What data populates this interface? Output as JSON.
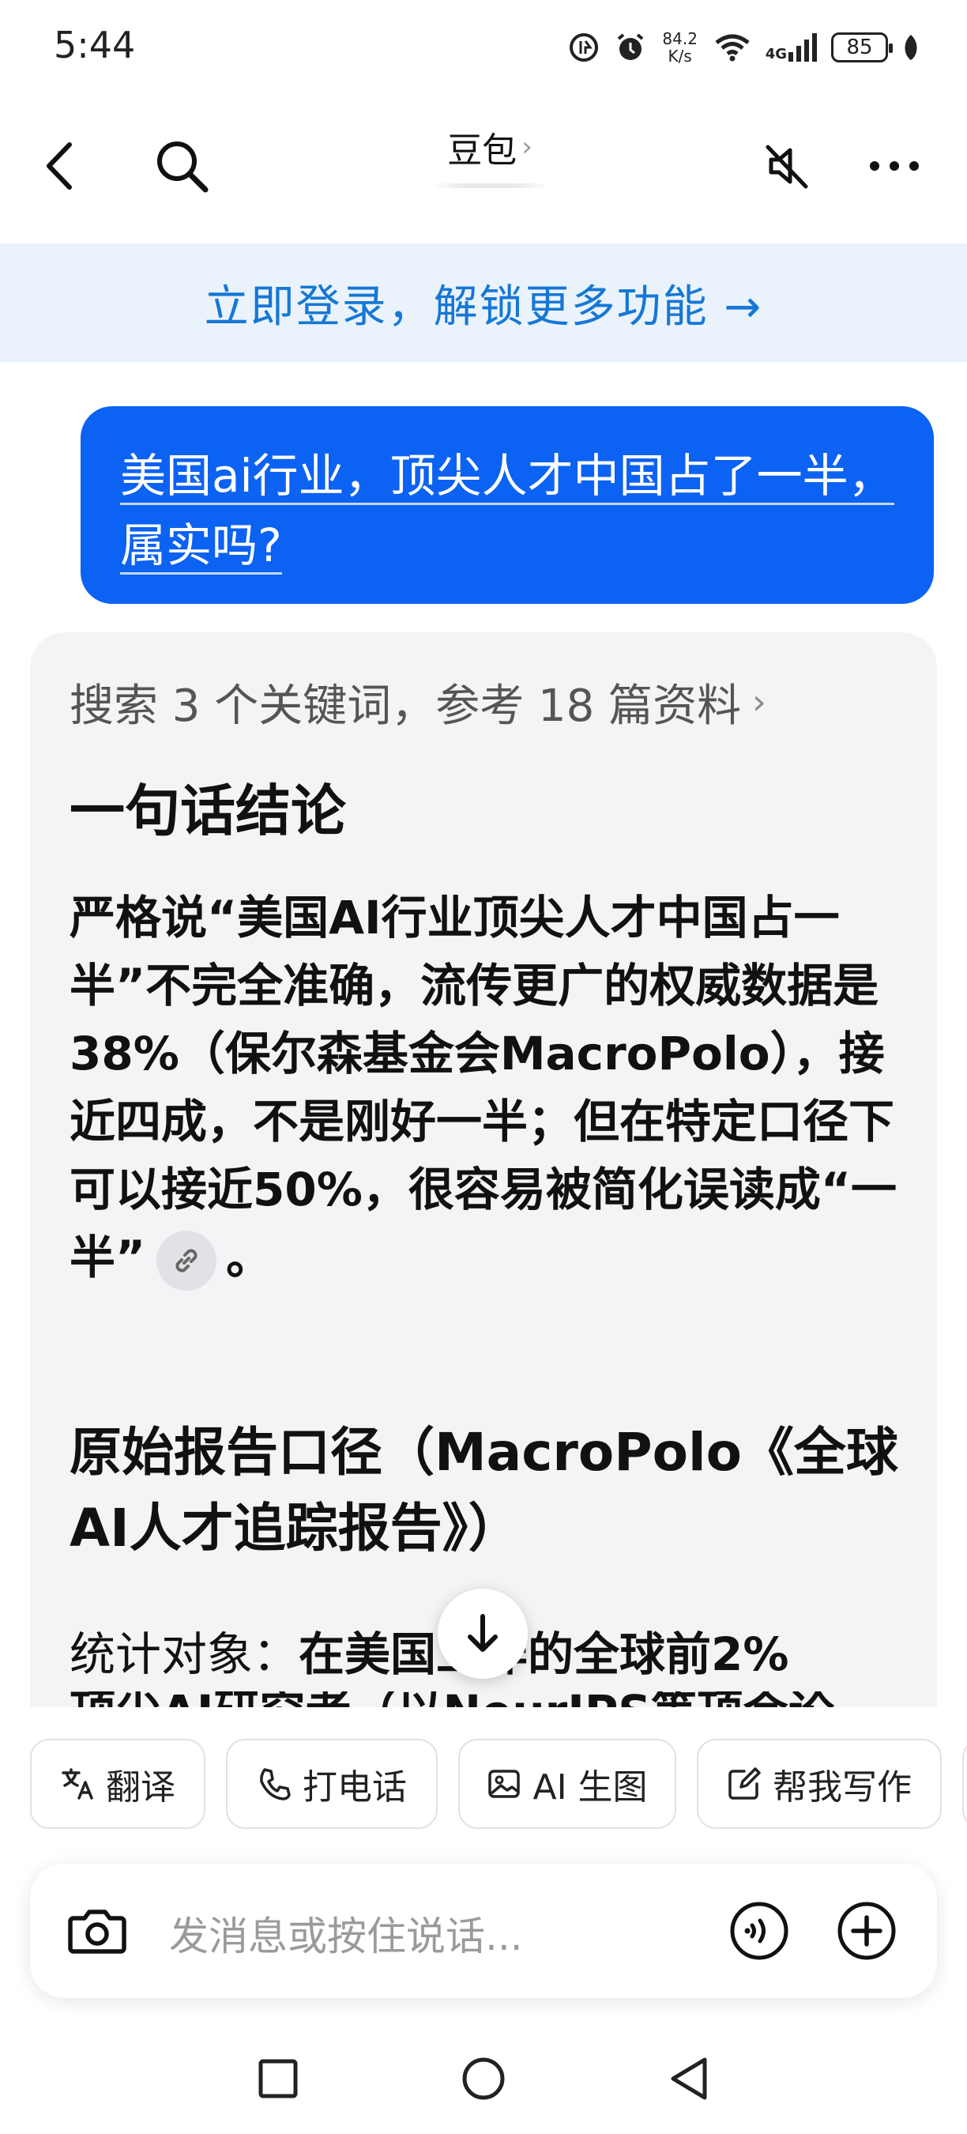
{
  "status_bar": {
    "time": "5:44",
    "net_speed_value": "84.2",
    "net_speed_unit": "K/s",
    "network_type": "4G",
    "battery": "85"
  },
  "header": {
    "title": "豆包",
    "title_chevron": "›"
  },
  "login_banner": {
    "text": "立即登录，解锁更多功能 →"
  },
  "user_message": {
    "text": "美国ai行业，顶尖人才中国占了一半，属实吗?"
  },
  "answer": {
    "references": "搜索 3 个关键词，参考 18 篇资料",
    "references_chevron": "›",
    "heading_conclusion": "一句话结论",
    "conclusion_text": "严格说“美国AI行业顶尖人才中国占一半”不完全准确，流传更广的权威数据是38%（保尔森基金会MacroPolo），接近四成，不是刚好一半；但在特定口径下可以接近50%，很容易被简化误读成“一半”",
    "conclusion_end": "。",
    "heading_report": "原始报告口径（MacroPolo《全球AI人才追踪报告》）",
    "stat_label": "统计对象：",
    "stat_value": "在美国工作的全球前2%",
    "cut_off_line": "顶尖AI研究者（以NeurIPS等顶会论"
  },
  "shortcuts": [
    {
      "label": "翻译",
      "icon": "translate-icon"
    },
    {
      "label": "打电话",
      "icon": "phone-icon"
    },
    {
      "label": "AI 生图",
      "icon": "image-icon"
    },
    {
      "label": "帮我写作",
      "icon": "edit-icon"
    }
  ],
  "input": {
    "placeholder": "发消息或按住说话..."
  },
  "colors": {
    "accent": "#0c62f2",
    "banner_text": "#1677d6",
    "banner_bg": "#eaf3fb",
    "card_bg": "#f4f4f6"
  }
}
